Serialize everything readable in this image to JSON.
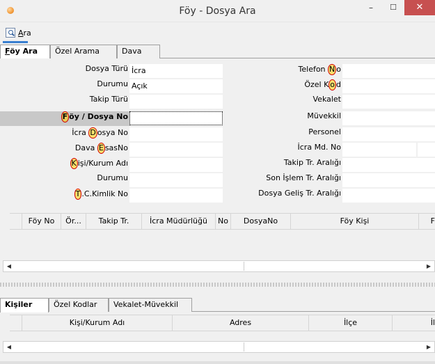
{
  "window": {
    "title": "Föy - Dosya Ara",
    "minimize": "–",
    "maximize": "☐",
    "close": "✕"
  },
  "toolbar": {
    "search_label": "Ara",
    "search_accel": "A",
    "search_rest": "ra",
    "search_icon": "search-icon"
  },
  "tabs": [
    {
      "label": "Föy Ara",
      "accel": "F",
      "rest": "öy Ara",
      "active": true
    },
    {
      "label": "Özel Arama",
      "active": false
    },
    {
      "label": "Dava",
      "active": false
    }
  ],
  "left_fields": [
    {
      "label": "Dosya Türü",
      "value": "İcra"
    },
    {
      "label": "Durumu",
      "value": "Açık"
    },
    {
      "label": "Takip Türü",
      "value": ""
    },
    {
      "label_pre": "",
      "label_accel": "F",
      "label_post": "öy / Dosya No",
      "label": "Föy / Dosya No",
      "value": "",
      "selected": true
    },
    {
      "label_pre": "İcra ",
      "label_accel": "D",
      "label_post": "osya No",
      "label": "İcra Dosya No",
      "value": ""
    },
    {
      "label_pre": "Dava ",
      "label_accel": "E",
      "label_post": "sasNo",
      "label": "Dava EsasNo",
      "value": ""
    },
    {
      "label_pre": "",
      "label_accel": "K",
      "label_post": "işi/Kurum Adı",
      "label": "Kişi/Kurum Adı",
      "value": ""
    },
    {
      "label": "Durumu",
      "value": ""
    },
    {
      "label_pre": "",
      "label_accel": "T",
      "label_post": ".C.Kimlik No",
      "label": "T.C.Kimlik No",
      "value": ""
    }
  ],
  "right_fields": [
    {
      "label_pre": "Telefon ",
      "label_accel": "N",
      "label_post": "o",
      "label": "Telefon No",
      "value": ""
    },
    {
      "label_pre": "Özel K",
      "label_accel": "o",
      "label_post": "d",
      "label": "Özel Kod",
      "value": ""
    },
    {
      "label": "Vekalet",
      "value": ""
    },
    {
      "label": "Müvekkil",
      "value": ""
    },
    {
      "label": "Personel",
      "value": ""
    },
    {
      "label": "İcra Md. No",
      "value": ""
    },
    {
      "label": "Takip Tr. Aralığı",
      "value": ""
    },
    {
      "label": "Son İşlem Tr. Aralığı",
      "value": ""
    },
    {
      "label": "Dosya Geliş Tr. Aralığı",
      "value": ""
    }
  ],
  "results_grid": {
    "columns": [
      "Föy No",
      "Ör...",
      "Takip Tr.",
      "İcra Müdürlüğü",
      "No",
      "DosyaNo",
      "Föy Kişi",
      "F"
    ]
  },
  "bottom_tabs": [
    {
      "label": "Kişiler",
      "active": true
    },
    {
      "label": "Özel Kodlar",
      "active": false
    },
    {
      "label": "Vekalet-Müvekkil",
      "active": false
    }
  ],
  "persons_grid": {
    "columns": [
      "Kişi/Kurum Adı",
      "Adres",
      "İlçe",
      "İl"
    ]
  },
  "scroll_arrows": {
    "left": "◀",
    "right": "▶"
  },
  "colors": {
    "accent": "#3a7fd0",
    "close_button": "#c75050",
    "highlight": "#ffd200",
    "highlight_border": "#d10000"
  }
}
